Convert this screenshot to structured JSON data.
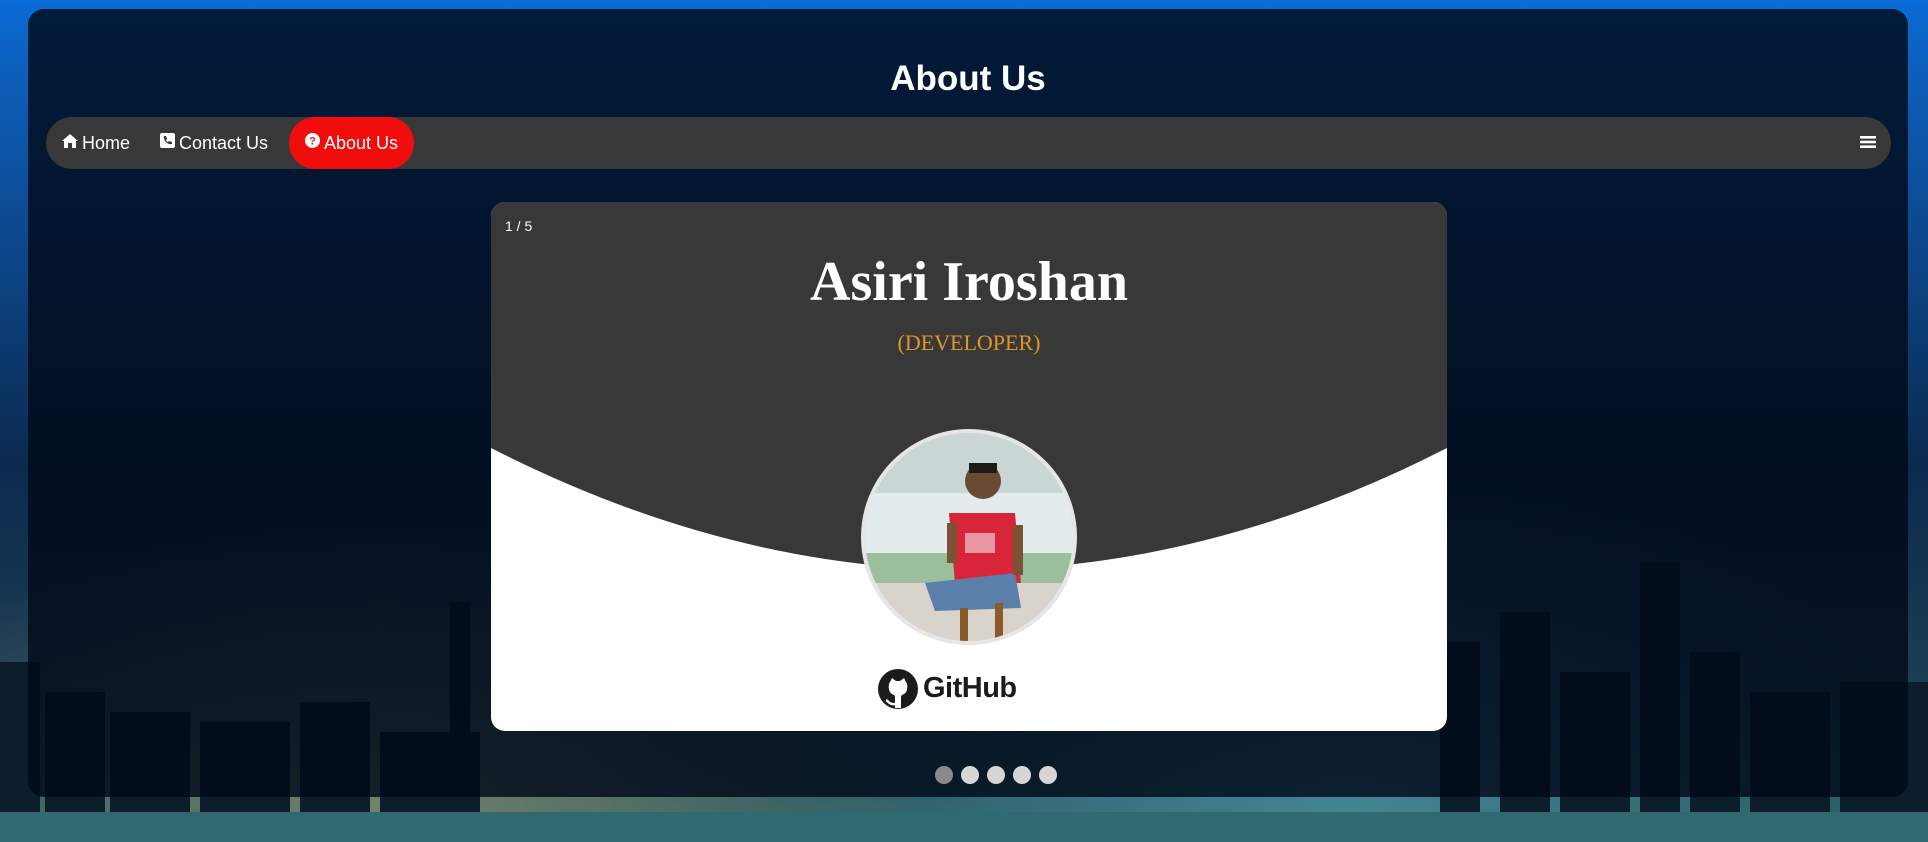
{
  "page": {
    "title": "About Us"
  },
  "nav": {
    "items": [
      {
        "label": "Home",
        "icon": "home-icon"
      },
      {
        "label": "Contact Us",
        "icon": "phone-icon"
      },
      {
        "label": "About Us",
        "icon": "question-circle-icon",
        "active": true
      }
    ],
    "menu_icon": "hamburger-menu-icon",
    "active_color": "#f20d0d"
  },
  "slideshow": {
    "counter": "1 / 5",
    "current_slide": 1,
    "total_slides": 5,
    "person": {
      "name": "Asiri Iroshan",
      "role": "(DEVELOPER)"
    },
    "github_label": "GitHub",
    "role_color": "#e0952a",
    "card_top_color": "#383838"
  }
}
